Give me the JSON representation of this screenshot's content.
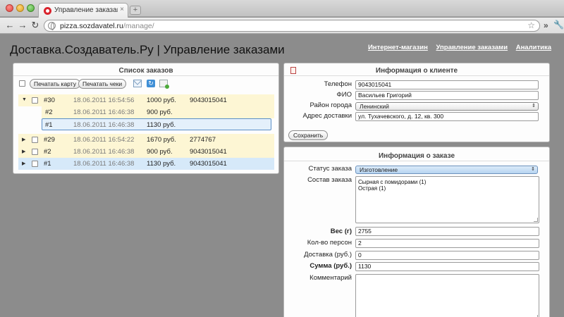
{
  "browser": {
    "tab_title": "Управление заказами | Дос",
    "tab_close": "×",
    "new_tab": "+",
    "url_domain": "pizza.sozdavatel.ru",
    "url_path": "/manage/",
    "back": "←",
    "forward": "→",
    "reload": "↻",
    "star": "☆",
    "more": "»",
    "wrench": "🔧"
  },
  "site": {
    "title": "Доставка.Создаватель.Ру | Управление заказами",
    "nav": [
      "Интернет-магазин",
      "Управление заказами",
      "Аналитика"
    ]
  },
  "orders": {
    "title": "Список заказов",
    "print_map": "Печатать карту",
    "print_checks": "Печатать чеки",
    "rows": [
      {
        "arrow": "▼",
        "id": "#30",
        "date": "18.06.2011 16:54:56",
        "sum": "1000 руб.",
        "phone": "9043015041",
        "style": "yellow"
      },
      {
        "arrow": "",
        "id": "#2",
        "date": "18.06.2011 16:46:38",
        "sum": "900 руб.",
        "phone": "",
        "style": "yellow"
      },
      {
        "arrow": "",
        "id": "#1",
        "date": "18.06.2011 16:46:38",
        "sum": "1130 руб.",
        "phone": "",
        "style": "sel"
      },
      {
        "arrow": "▶",
        "id": "#29",
        "date": "18.06.2011 16:54:22",
        "sum": "1670 руб.",
        "phone": "2774767",
        "style": "yellow"
      },
      {
        "arrow": "▶",
        "id": "#2",
        "date": "18.06.2011 16:46:38",
        "sum": "900 руб.",
        "phone": "9043015041",
        "style": "yellow"
      },
      {
        "arrow": "▶",
        "id": "#1",
        "date": "18.06.2011 16:46:38",
        "sum": "1130 руб.",
        "phone": "9043015041",
        "style": "blue"
      }
    ]
  },
  "client": {
    "title": "Информация о клиенте",
    "phone_label": "Телефон",
    "phone": "9043015041",
    "name_label": "ФИО",
    "name": "Васильев Григорий",
    "district_label": "Район города",
    "district": "Ленинский",
    "address_label": "Адрес доставки",
    "address": "ул. Тухачевского, д. 12, кв. 300",
    "save": "Сохранить"
  },
  "order": {
    "title": "Информация о заказе",
    "status_label": "Статус заказа",
    "status": "Изготовление",
    "items_label": "Состав заказа",
    "items": [
      "Сырная с помидорами (1)",
      "Острая (1)"
    ],
    "weight_label": "Вес (г)",
    "weight": "2755",
    "persons_label": "Кол-во персон",
    "persons": "2",
    "delivery_label": "Доставка (руб.)",
    "delivery": "0",
    "total_label": "Сумма (руб.)",
    "total": "1130",
    "comment_label": "Комментарий"
  }
}
